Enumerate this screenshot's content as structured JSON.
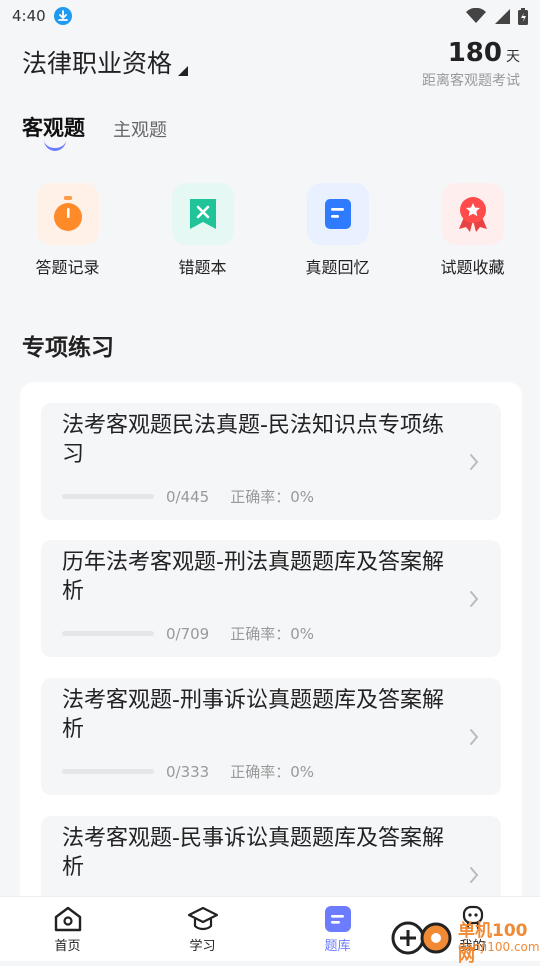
{
  "status_bar": {
    "time": "4:40"
  },
  "header": {
    "exam_title": "法律职业资格",
    "days_number": "180",
    "days_unit": "天",
    "countdown_label": "距离客观题考试"
  },
  "tabs": [
    {
      "label": "客观题",
      "active": true
    },
    {
      "label": "主观题",
      "active": false
    }
  ],
  "quick_actions": [
    {
      "label": "答题记录",
      "icon": "stopwatch-icon",
      "bg": "#fff1e8"
    },
    {
      "label": "错题本",
      "icon": "wrong-book-icon",
      "bg": "#e6f8f3"
    },
    {
      "label": "真题回忆",
      "icon": "document-icon",
      "bg": "#e9f0ff"
    },
    {
      "label": "试题收藏",
      "icon": "ribbon-star-icon",
      "bg": "#ffeeee"
    }
  ],
  "section": {
    "title": "专项练习"
  },
  "practice_items": [
    {
      "title": "法考客观题民法真题-民法知识点专项练习",
      "progress": "0/445",
      "accuracy": "正确率：0%",
      "progress_fraction": 0
    },
    {
      "title": "历年法考客观题-刑法真题题库及答案解析",
      "progress": "0/709",
      "accuracy": "正确率：0%",
      "progress_fraction": 0
    },
    {
      "title": "法考客观题-刑事诉讼真题题库及答案解析",
      "progress": "0/333",
      "accuracy": "正确率：0%",
      "progress_fraction": 0
    },
    {
      "title": "法考客观题-民事诉讼真题题库及答案解析",
      "progress": "",
      "accuracy": "",
      "progress_fraction": 0
    }
  ],
  "bottom_nav": [
    {
      "label": "首页",
      "icon": "home-icon",
      "active": false
    },
    {
      "label": "学习",
      "icon": "graduation-cap-icon",
      "active": false
    },
    {
      "label": "题库",
      "icon": "question-bank-icon",
      "active": true
    },
    {
      "label": "我的",
      "icon": "profile-icon",
      "active": false
    }
  ],
  "watermark": {
    "line1": "单机100网",
    "line2": "danji100.com"
  },
  "colors": {
    "accent": "#6b7cff",
    "muted_text": "#999999",
    "card_bg": "#f5f6f8"
  }
}
